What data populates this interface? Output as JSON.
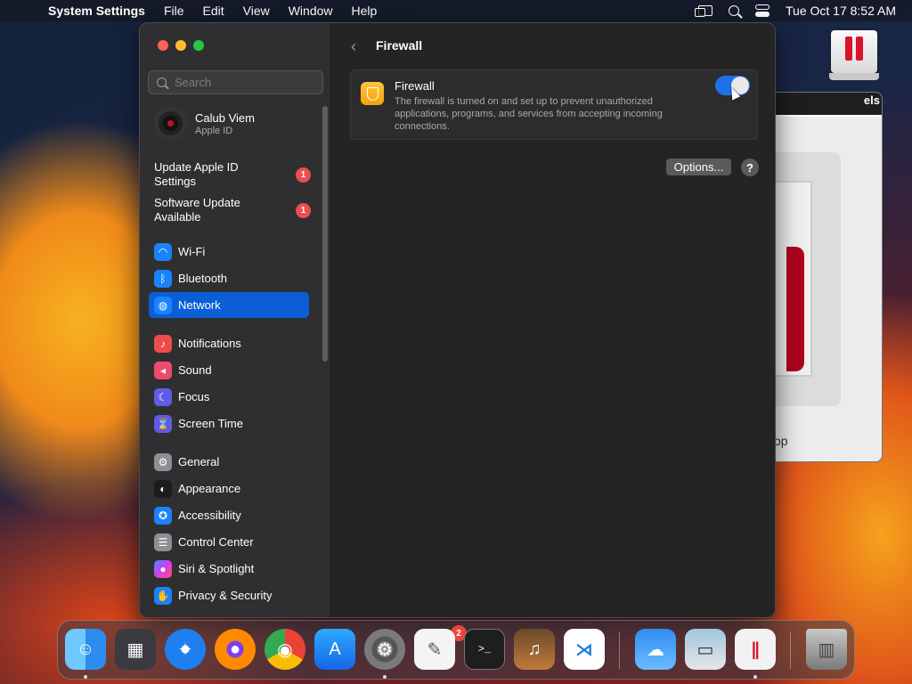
{
  "menubar": {
    "app_name": "System Settings",
    "menus": [
      "File",
      "Edit",
      "View",
      "Window",
      "Help"
    ],
    "datetime": "Tue Oct 17  8:52 AM"
  },
  "background_window": {
    "title_fragment": "els",
    "label_fragment": "op"
  },
  "sidebar": {
    "search_placeholder": "Search",
    "profile": {
      "name": "Calub Viem",
      "subtitle": "Apple ID"
    },
    "notices": [
      {
        "label": "Update Apple ID Settings",
        "badge": "1"
      },
      {
        "label": "Software Update Available",
        "badge": "1"
      }
    ],
    "items": [
      {
        "label": "Wi-Fi",
        "icon": "wifi-icon",
        "color": "#1a82fb"
      },
      {
        "label": "Bluetooth",
        "icon": "bluetooth-icon",
        "color": "#1a82fb"
      },
      {
        "label": "Network",
        "icon": "globe-icon",
        "color": "#1a82fb",
        "selected": true
      },
      {
        "label": "Notifications",
        "icon": "bell-icon",
        "color": "#ee4b4b"
      },
      {
        "label": "Sound",
        "icon": "speaker-icon",
        "color": "#ee4b6e"
      },
      {
        "label": "Focus",
        "icon": "moon-icon",
        "color": "#5e5ce6"
      },
      {
        "label": "Screen Time",
        "icon": "hourglass-icon",
        "color": "#5e5ce6"
      },
      {
        "label": "General",
        "icon": "gear-icon",
        "color": "#8e8e93"
      },
      {
        "label": "Appearance",
        "icon": "appearance-icon",
        "color": "#1c1c1e"
      },
      {
        "label": "Accessibility",
        "icon": "accessibility-icon",
        "color": "#1a82fb"
      },
      {
        "label": "Control Center",
        "icon": "control-center-icon",
        "color": "#8e8e93"
      },
      {
        "label": "Siri & Spotlight",
        "icon": "siri-icon",
        "color": "#b03cf0"
      },
      {
        "label": "Privacy & Security",
        "icon": "hand-icon",
        "color": "#1a82fb"
      }
    ]
  },
  "content": {
    "title": "Firewall",
    "firewall": {
      "name": "Firewall",
      "description": "The firewall is turned on and set up to prevent unauthorized applications, programs, and services from accepting incoming connections.",
      "enabled": true
    },
    "options_label": "Options...",
    "help_label": "?"
  },
  "dock": {
    "apps": [
      "finder",
      "launchpad",
      "safari",
      "firefox",
      "chrome",
      "app-store",
      "system-settings",
      "textedit",
      "terminal",
      "garageband",
      "vscode",
      "weather",
      "preview",
      "parallels",
      "trash"
    ],
    "system_settings_badge": "2"
  },
  "colors": {
    "accent": "#0a5fd6",
    "toggle_on": "#1f6fe8",
    "badge": "#eb4f4f"
  }
}
